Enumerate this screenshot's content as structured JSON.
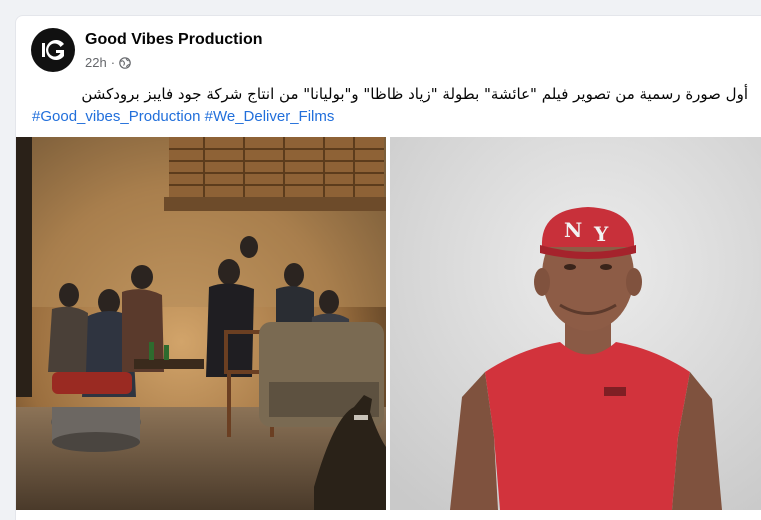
{
  "post": {
    "page_name": "Good Vibes Production",
    "timestamp": "22h",
    "privacy_icon": "globe-icon",
    "caption": "أول صورة رسمية من تصوير فيلم \"عائشة\" بطولة \"زياد ظاظا\" و\"بوليانا\" من انتاج شركة جود فايبز برودكشن",
    "hashtags": [
      "#Good_vibes_Production",
      "#We_Deliver_Films"
    ]
  },
  "photos": [
    {
      "name": "film-scene-photo"
    },
    {
      "name": "actor-portrait-photo",
      "cap_text": "N Y"
    }
  ],
  "colors": {
    "link": "#216fdb",
    "card_bg": "#ffffff",
    "page_bg": "#f0f2f5"
  }
}
